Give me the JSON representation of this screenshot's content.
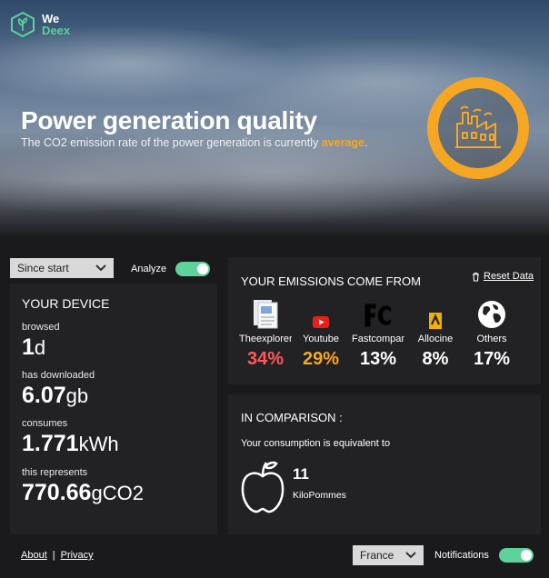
{
  "app": {
    "logo_line1": "We",
    "logo_line2": "Deex"
  },
  "hero": {
    "title": "Power generation quality",
    "subtitle_prefix": "The CO2 emission rate of the power generation is currently ",
    "subtitle_highlight": "average",
    "subtitle_suffix": ".",
    "badge_icon": "factory-icon",
    "accent_color": "#f5a623"
  },
  "controls": {
    "period_select": "Since start",
    "analyze_label": "Analyze",
    "analyze_on": true,
    "toggle_color": "#5bd39a"
  },
  "device": {
    "title": "YOUR DEVICE",
    "browsed_label": "browsed",
    "browsed_value": "1",
    "browsed_unit": "d",
    "downloaded_label": "has downloaded",
    "downloaded_value": "6.07",
    "downloaded_unit": "gb",
    "consumes_label": "consumes",
    "consumes_value": "1.771",
    "consumes_unit": "kWh",
    "represents_label": "this represents",
    "represents_value": "770.66",
    "represents_unit": "gCO2"
  },
  "emissions": {
    "title": "YOUR EMISSIONS COME FROM",
    "reset_label": "Reset Data",
    "sources": [
      {
        "name": "Theexplorer",
        "percent": "34%",
        "color": "#ff5a5a",
        "icon": "document-icon"
      },
      {
        "name": "Youtube",
        "percent": "29%",
        "color": "#f5a623",
        "icon": "youtube-icon"
      },
      {
        "name": "Fastcompany",
        "percent": "13%",
        "color": "#ffffff",
        "icon": "fc-logo-icon"
      },
      {
        "name": "Allocine",
        "percent": "8%",
        "color": "#ffffff",
        "icon": "allocine-icon"
      },
      {
        "name": "Others",
        "percent": "17%",
        "color": "#ffffff",
        "icon": "globe-icon"
      }
    ]
  },
  "comparison": {
    "title": "IN COMPARISON :",
    "subtitle": "Your consumption is equivalent to",
    "value": "11",
    "unit": "KiloPommes",
    "icon": "apple-icon"
  },
  "footer": {
    "about": "About",
    "separator": "|",
    "privacy": "Privacy",
    "country": "France",
    "notifications_label": "Notifications",
    "notifications_on": true
  }
}
